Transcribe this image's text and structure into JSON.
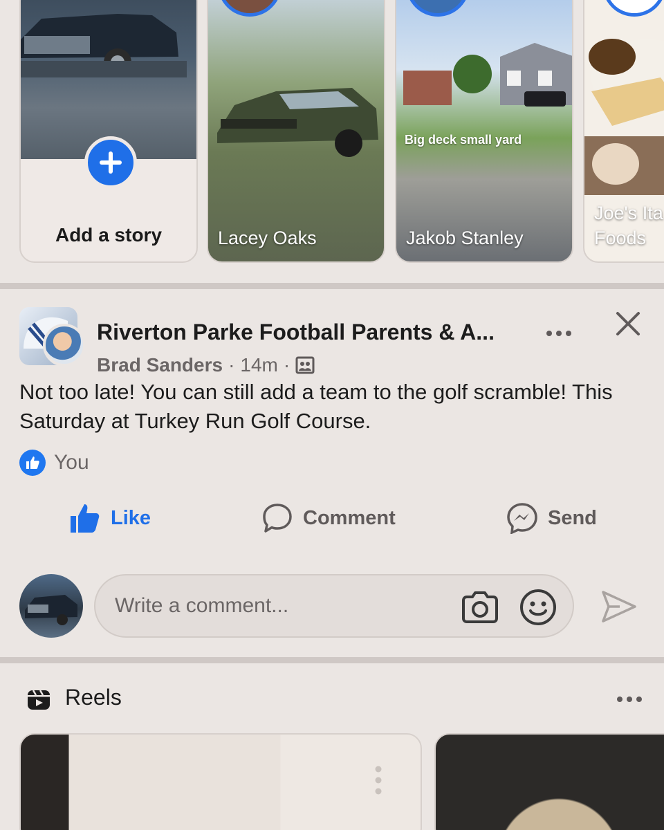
{
  "stories": {
    "add_label": "Add a story",
    "items": [
      {
        "name": "Lacey Oaks"
      },
      {
        "name": "Jakob Stanley",
        "caption": "Big deck small yard"
      },
      {
        "name_line1": "Joe's Ita",
        "name_line2": "Foods"
      }
    ]
  },
  "post": {
    "group_name": "Riverton Parke Football Parents & A...",
    "author": "Brad Sanders",
    "time": "14m",
    "separator": "·",
    "text": "Not too late! You can still add a team to the golf scramble! This Saturday at Turkey Run Golf Course.",
    "reactors": "You",
    "actions": {
      "like": "Like",
      "comment": "Comment",
      "send": "Send"
    },
    "comment_placeholder": "Write a comment..."
  },
  "reels": {
    "title": "Reels"
  },
  "colors": {
    "accent": "#1f6fe8",
    "background": "#ebe6e3",
    "divider": "#cfc8c5"
  },
  "icons": [
    "plus-icon",
    "more-icon",
    "close-icon",
    "group-icon",
    "like-icon",
    "comment-icon",
    "messenger-icon",
    "camera-icon",
    "emoji-icon",
    "send-icon",
    "reels-icon"
  ]
}
